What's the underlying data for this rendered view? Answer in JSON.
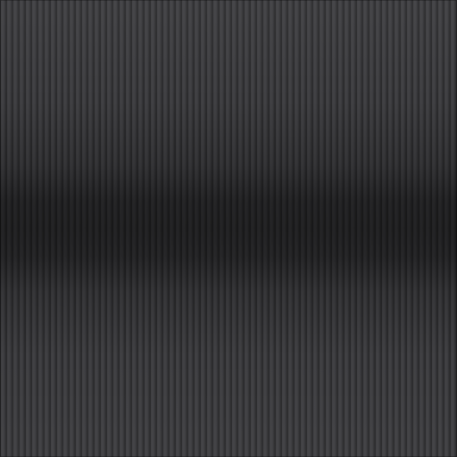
{
  "texture": {
    "kind": "vertical-ribbed-metal",
    "base_color": "#3a3a3c",
    "rib_dark": "#2b2b2d",
    "rib_light": "#424245",
    "shadow_band": "horizontal-dark-center"
  }
}
